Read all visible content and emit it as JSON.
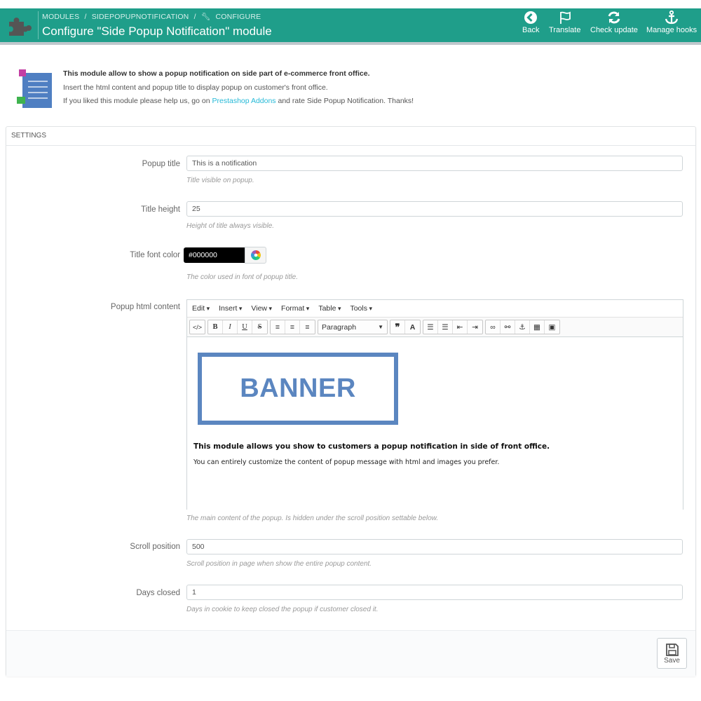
{
  "header": {
    "breadcrumb": [
      "MODULES",
      "/",
      "SIDEPOPUPNOTIFICATION",
      "/",
      "CONFIGURE"
    ],
    "title": "Configure \"Side Popup Notification\" module",
    "buttons": {
      "back": "Back",
      "translate": "Translate",
      "check_update": "Check update",
      "manage_hooks": "Manage hooks"
    },
    "colors": {
      "bar": "#1f9e8a"
    }
  },
  "intro": {
    "line1": "This module allow to show a popup notification on side part of e-commerce front office.",
    "line2": "Insert the html content and popup title to display popup on customer's front office.",
    "line3_prefix": "If you liked this module please help us, go on",
    "line3_link": "Prestashop Addons",
    "line3_suffix": "and rate Side Popup Notification. Thanks!"
  },
  "panel": {
    "heading": "SETTINGS",
    "fields": {
      "popup_title": {
        "label": "Popup title",
        "value": "This is a notification",
        "help": "Title visible on popup."
      },
      "title_height": {
        "label": "Title height",
        "value": "25",
        "help": "Height of title always visible."
      },
      "title_font_color": {
        "label": "Title font color",
        "value": "#000000",
        "help": "The color used in font of popup title."
      },
      "popup_html_content": {
        "label": "Popup html content",
        "help": "The main content of the popup. Is hidden under the scroll position settable below."
      },
      "scroll_position": {
        "label": "Scroll position",
        "value": "500",
        "help": "Scroll position in page when show the entire popup content."
      },
      "days_closed": {
        "label": "Days closed",
        "value": "1",
        "help": "Days in cookie to keep closed the popup if customer closed it."
      }
    },
    "save_label": "Save"
  },
  "editor": {
    "menus": [
      "Edit",
      "Insert",
      "View",
      "Format",
      "Table",
      "Tools"
    ],
    "format_select": "Paragraph",
    "banner_text": "BANNER",
    "content_bold": "This module allows you show to customers a popup notification in side of front office.",
    "content_text": "You can entirely customize the content of popup message with html and images you prefer.",
    "colors": {
      "banner": "#5b86c0"
    }
  }
}
